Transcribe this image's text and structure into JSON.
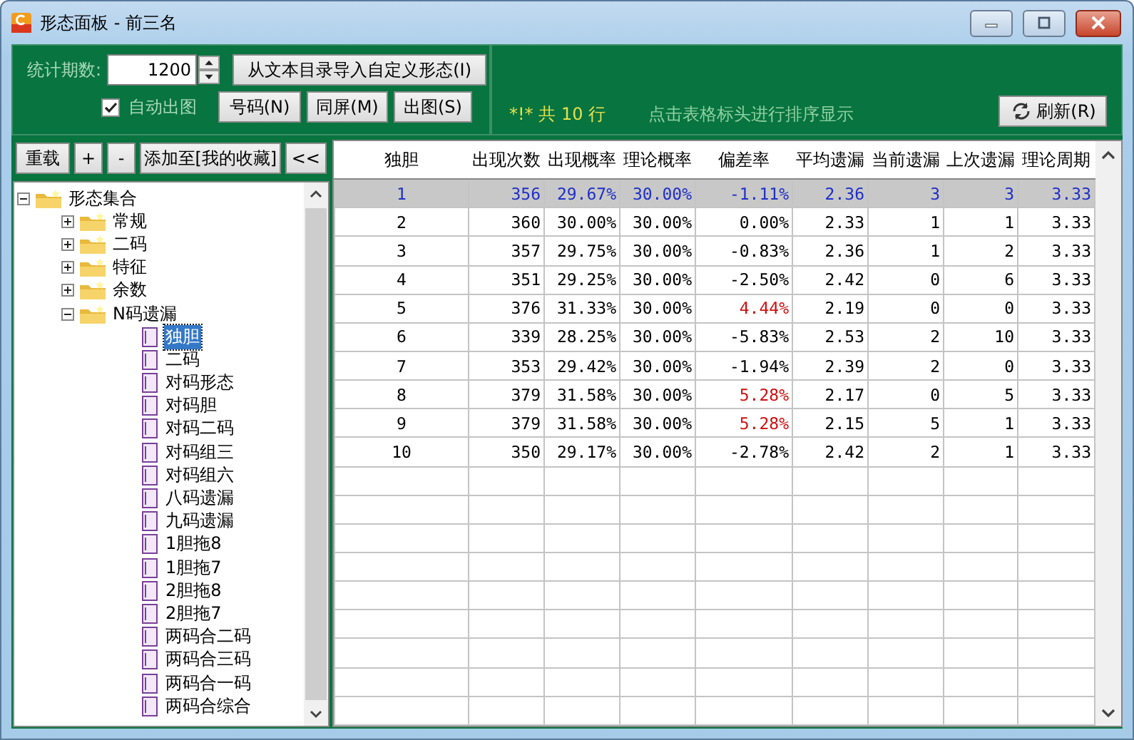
{
  "window": {
    "title": "形态面板 - 前三名"
  },
  "toolbar": {
    "period_label": "统计期数:",
    "period_value": "1200",
    "auto_chart": {
      "label": "自动出图",
      "checked": true
    },
    "import_button": "从文本目录导入自定义形态(I)",
    "buttons": [
      "号码(N)",
      "同屏(M)",
      "出图(S)"
    ],
    "status": "*!* 共 10 行",
    "hint": "点击表格标头进行排序显示",
    "refresh_button": "刷新(R)"
  },
  "panel_buttons": [
    "重载",
    "+",
    "-",
    "添加至[我的收藏]",
    "<<"
  ],
  "tree": [
    {
      "label": "形态集合",
      "kind": "folder",
      "expanded": true,
      "selected": false,
      "children": [
        {
          "label": "常规",
          "kind": "folder",
          "expanded": false,
          "selected": false
        },
        {
          "label": "二码",
          "kind": "folder",
          "expanded": false,
          "selected": false
        },
        {
          "label": "特征",
          "kind": "folder",
          "expanded": false,
          "selected": false
        },
        {
          "label": "余数",
          "kind": "folder",
          "expanded": false,
          "selected": false
        },
        {
          "label": "N码遗漏",
          "kind": "folder",
          "expanded": true,
          "selected": false,
          "children": [
            {
              "label": "独胆",
              "kind": "page",
              "selected": true
            },
            {
              "label": "二码",
              "kind": "page",
              "selected": false
            },
            {
              "label": "对码形态",
              "kind": "page",
              "selected": false
            },
            {
              "label": "对码胆",
              "kind": "page",
              "selected": false
            },
            {
              "label": "对码二码",
              "kind": "page",
              "selected": false
            },
            {
              "label": "对码组三",
              "kind": "page",
              "selected": false
            },
            {
              "label": "对码组六",
              "kind": "page",
              "selected": false
            },
            {
              "label": "八码遗漏",
              "kind": "page",
              "selected": false
            },
            {
              "label": "九码遗漏",
              "kind": "page",
              "selected": false
            },
            {
              "label": "1胆拖8",
              "kind": "page",
              "selected": false
            },
            {
              "label": "1胆拖7",
              "kind": "page",
              "selected": false
            },
            {
              "label": "2胆拖8",
              "kind": "page",
              "selected": false
            },
            {
              "label": "2胆拖7",
              "kind": "page",
              "selected": false
            },
            {
              "label": "两码合二码",
              "kind": "page",
              "selected": false
            },
            {
              "label": "两码合三码",
              "kind": "page",
              "selected": false
            },
            {
              "label": "两码合一码",
              "kind": "page",
              "selected": false
            },
            {
              "label": "两码合综合",
              "kind": "page",
              "selected": false
            }
          ]
        }
      ]
    }
  ],
  "table": {
    "columns": [
      "独胆",
      "出现次数",
      "出现概率",
      "理论概率",
      "偏差率",
      "平均遗漏",
      "当前遗漏",
      "上次遗漏",
      "理论周期"
    ],
    "rows": [
      {
        "selected": true,
        "deviation_high": false,
        "cells": [
          "1",
          "356",
          "29.67%",
          "30.00%",
          "-1.11%",
          "2.36",
          "3",
          "3",
          "3.33"
        ]
      },
      {
        "selected": false,
        "deviation_high": false,
        "cells": [
          "2",
          "360",
          "30.00%",
          "30.00%",
          "0.00%",
          "2.33",
          "1",
          "1",
          "3.33"
        ]
      },
      {
        "selected": false,
        "deviation_high": false,
        "cells": [
          "3",
          "357",
          "29.75%",
          "30.00%",
          "-0.83%",
          "2.36",
          "1",
          "2",
          "3.33"
        ]
      },
      {
        "selected": false,
        "deviation_high": false,
        "cells": [
          "4",
          "351",
          "29.25%",
          "30.00%",
          "-2.50%",
          "2.42",
          "0",
          "6",
          "3.33"
        ]
      },
      {
        "selected": false,
        "deviation_high": true,
        "cells": [
          "5",
          "376",
          "31.33%",
          "30.00%",
          "4.44%",
          "2.19",
          "0",
          "0",
          "3.33"
        ]
      },
      {
        "selected": false,
        "deviation_high": false,
        "cells": [
          "6",
          "339",
          "28.25%",
          "30.00%",
          "-5.83%",
          "2.53",
          "2",
          "10",
          "3.33"
        ]
      },
      {
        "selected": false,
        "deviation_high": false,
        "cells": [
          "7",
          "353",
          "29.42%",
          "30.00%",
          "-1.94%",
          "2.39",
          "2",
          "0",
          "3.33"
        ]
      },
      {
        "selected": false,
        "deviation_high": true,
        "cells": [
          "8",
          "379",
          "31.58%",
          "30.00%",
          "5.28%",
          "2.17",
          "0",
          "5",
          "3.33"
        ]
      },
      {
        "selected": false,
        "deviation_high": true,
        "cells": [
          "9",
          "379",
          "31.58%",
          "30.00%",
          "5.28%",
          "2.15",
          "5",
          "1",
          "3.33"
        ]
      },
      {
        "selected": false,
        "deviation_high": false,
        "cells": [
          "10",
          "350",
          "29.17%",
          "30.00%",
          "-2.78%",
          "2.42",
          "2",
          "1",
          "3.33"
        ]
      }
    ]
  }
}
